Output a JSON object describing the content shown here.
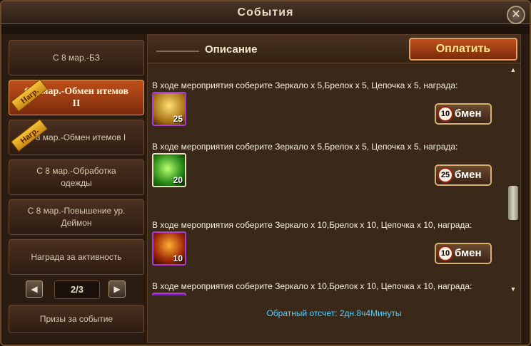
{
  "window": {
    "title": "События",
    "close_glyph": "✕"
  },
  "sidebar": {
    "items": [
      {
        "label": "С 8 мар.-БЗ",
        "active": false,
        "badge": ""
      },
      {
        "label": "С 8 мар.-Обмен итемов  II",
        "active": true,
        "badge": "Нагр."
      },
      {
        "label": "С 8 мар.-Обмен итемов I",
        "active": false,
        "badge": "Нагр."
      },
      {
        "label": "С 8 мар.-Обработка одежды",
        "active": false,
        "badge": ""
      },
      {
        "label": "С 8 мар.-Повышение ур. Деймон",
        "active": false,
        "badge": ""
      },
      {
        "label": "Награда за активность",
        "active": false,
        "badge": ""
      }
    ],
    "pager": {
      "value": "2/3",
      "prev_glyph": "◀",
      "next_glyph": "▶"
    },
    "prizes_label": "Призы за событие"
  },
  "main": {
    "description_title": "Описание",
    "pay_label": "Оплатить",
    "tasks": [
      {
        "text": "В ходе мероприятия соберите Зеркало x 5,Брелок x 5, Цепочка x 5,  награда:",
        "count": "25",
        "exchange_num": "10",
        "exchange_label": "бмен",
        "icon": "gold-figure-icon"
      },
      {
        "text": "В ходе мероприятия соберите Зеркало x 5,Брелок x 5, Цепочка x 5,  награда:",
        "count": "20",
        "exchange_num": "25",
        "exchange_label": "бмен",
        "icon": "green-orb-icon"
      },
      {
        "text": "В ходе мероприятия соберите Зеркало x 10,Брелок x 10, Цепочка x 10,  награда:",
        "count": "10",
        "exchange_num": "10",
        "exchange_label": "бмен",
        "icon": "fire-warrior-icon"
      },
      {
        "text": "В ходе мероприятия соберите Зеркало x 10,Брелок x 10, Цепочка x 10,  награда:",
        "count": "",
        "exchange_num": "",
        "exchange_label": "",
        "icon": "purple-item-icon"
      }
    ],
    "countdown": "Обратный отсчет: 2дн.8ч4Минуты"
  },
  "colors": {
    "accent": "#c0501a",
    "countdown": "#56d0ff",
    "frame": "#b03ad8"
  }
}
